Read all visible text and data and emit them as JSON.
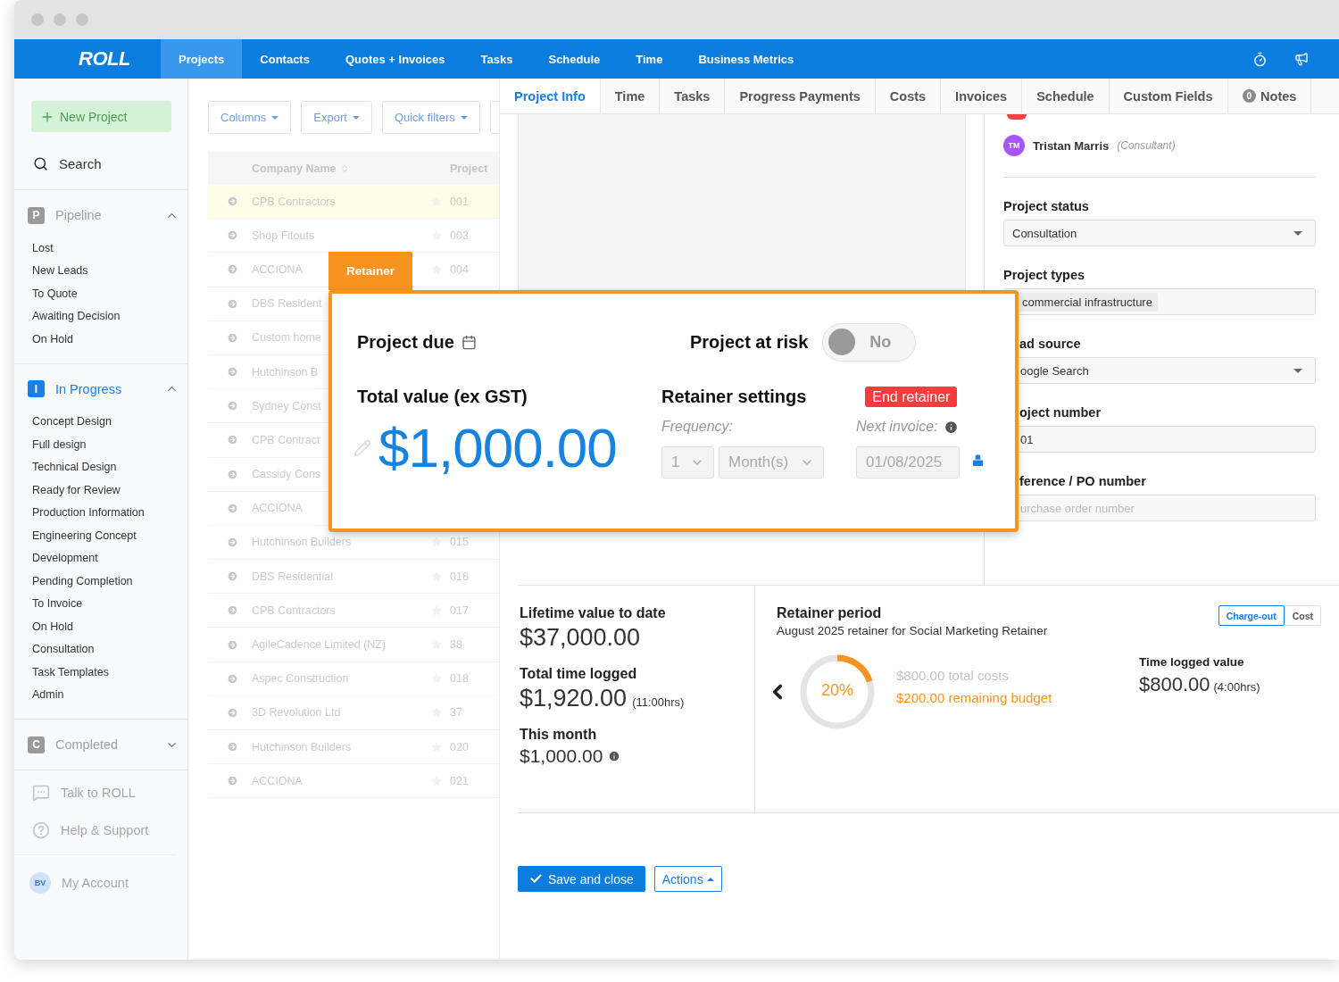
{
  "nav": {
    "logo": "ROLL",
    "tabs": [
      {
        "label": "Projects",
        "selected": true
      },
      {
        "label": "Contacts",
        "selected": false
      },
      {
        "label": "Quotes + Invoices",
        "selected": false
      },
      {
        "label": "Tasks",
        "selected": false
      },
      {
        "label": "Schedule",
        "selected": false
      },
      {
        "label": "Time",
        "selected": false
      },
      {
        "label": "Business Metrics",
        "selected": false
      }
    ]
  },
  "sidebar": {
    "new_project": "New Project",
    "search": "Search",
    "groups": [
      {
        "badge": "P",
        "label": "Pipeline",
        "expanded": true,
        "active": false,
        "items": [
          "Lost",
          "New Leads",
          "To Quote",
          "Awaiting Decision",
          "On Hold"
        ]
      },
      {
        "badge": "I",
        "label": "In Progress",
        "expanded": true,
        "active": true,
        "items": [
          "Concept Design",
          "Full design",
          "Technical Design",
          "Ready for Review",
          "Production Information",
          "Engineering Concept",
          "Development",
          "Pending Completion",
          "To Invoice",
          "On Hold",
          "Consultation",
          "Task Templates",
          "Admin"
        ]
      },
      {
        "badge": "C",
        "label": "Completed",
        "expanded": false,
        "active": false
      }
    ],
    "links": [
      {
        "kind": "chat",
        "label": "Talk to ROLL"
      },
      {
        "kind": "help",
        "label": "Help & Support"
      }
    ],
    "account": {
      "initials": "BV",
      "label": "My Account"
    }
  },
  "table": {
    "toolbar": [
      "Columns",
      "Export",
      "Quick filters"
    ],
    "columns": [
      "Company Name",
      "Project"
    ],
    "rows": [
      {
        "name": "CPB Contractors",
        "number": "001",
        "selected": true
      },
      {
        "name": "Shop Fitouts",
        "number": "003",
        "selected": false
      },
      {
        "name": "ACCIONA",
        "number": "004",
        "selected": false
      },
      {
        "name": "DBS Resident",
        "selected": false
      },
      {
        "name": "Custom home",
        "selected": false
      },
      {
        "name": "Hutchinson B",
        "selected": false
      },
      {
        "name": "Sydney Const",
        "selected": false
      },
      {
        "name": "CPB Contract",
        "selected": false
      },
      {
        "name": "Cassidy Cons",
        "selected": false
      },
      {
        "name": "ACCIONA",
        "selected": false
      },
      {
        "name": "Hutchinson Builders",
        "number": "015",
        "selected": false
      },
      {
        "name": "DBS Residential",
        "number": "016",
        "selected": false
      },
      {
        "name": "CPB Contractors",
        "number": "017",
        "selected": false
      },
      {
        "name": "AgileCadence Limited (NZ)",
        "number": "38",
        "selected": false
      },
      {
        "name": "Aspec Construction",
        "number": "018",
        "selected": false
      },
      {
        "name": "3D Revolution Ltd",
        "number": "37",
        "selected": false
      },
      {
        "name": "Hutchinson Builders",
        "number": "020",
        "selected": false
      },
      {
        "name": "ACCIONA",
        "number": "021",
        "selected": false
      }
    ]
  },
  "detail": {
    "tabs": [
      {
        "label": "Project Info",
        "selected": true
      },
      {
        "label": "Time",
        "selected": false
      },
      {
        "label": "Tasks",
        "selected": false
      },
      {
        "label": "Progress Payments",
        "selected": false
      },
      {
        "label": "Costs",
        "selected": false
      },
      {
        "label": "Invoices",
        "selected": false
      },
      {
        "label": "Schedule",
        "selected": false
      },
      {
        "label": "Custom Fields",
        "selected": false
      },
      {
        "label": "Notes",
        "selected": false,
        "badge": "0"
      }
    ],
    "people": [
      {
        "initials": "TM",
        "name": "Tristan Marris",
        "role": "(Consultant)"
      }
    ],
    "fields": [
      {
        "kind": "select",
        "label": "Project status",
        "value": "Consultation",
        "cut": false
      },
      {
        "kind": "tags",
        "label": "Project types",
        "tags": [
          "commercial infrastructure"
        ],
        "cut": false
      },
      {
        "kind": "select",
        "label": "ad source",
        "value": "oogle Search",
        "cut": true
      },
      {
        "kind": "text",
        "label": "oject number",
        "value": "01",
        "cut": true
      },
      {
        "kind": "text",
        "label": "ference / PO number",
        "placeholder": "urchase order number",
        "cut": true
      }
    ],
    "stats": [
      {
        "kind": "primary",
        "label": "Lifetime value to date",
        "value": "$37,000.00",
        "info": false
      },
      {
        "kind": "primary",
        "label": "Total time logged",
        "value": "$1,920.00",
        "note": "(11:00hrs)",
        "info": false
      },
      {
        "kind": "minor",
        "label": "This month",
        "value": "$1,000.00",
        "info": true
      }
    ],
    "retainer_period": {
      "title": "Retainer period",
      "subtitle": "August 2025 retainer for Social Marketing Retainer",
      "modes": [
        {
          "label": "Charge-out",
          "selected": true
        },
        {
          "label": "Cost",
          "selected": false
        }
      ],
      "budget": {
        "level": 0.2,
        "label": "20%"
      },
      "total_costs": "$800.00 total costs",
      "remaining": "$200.00 remaining budget",
      "time_label": "Time logged value",
      "time_value": "$800.00",
      "time_hours": "(4:00hrs)"
    },
    "actions": {
      "save": "Save and close",
      "more": "Actions"
    }
  },
  "popup": {
    "tab": "Retainer",
    "due_label": "Project due",
    "risk_label": "Project at risk",
    "risk_toggle": {
      "on": false,
      "label": "No"
    },
    "total_label": "Total value (ex GST)",
    "total_value": "$1,000.00",
    "settings_label": "Retainer settings",
    "end_button": "End retainer",
    "frequency_label": "Frequency:",
    "frequency_count": "1",
    "frequency_unit": "Month(s)",
    "next_invoice_label": "Next invoice:",
    "next_invoice_date": "01/08/2025",
    "locked": true
  }
}
